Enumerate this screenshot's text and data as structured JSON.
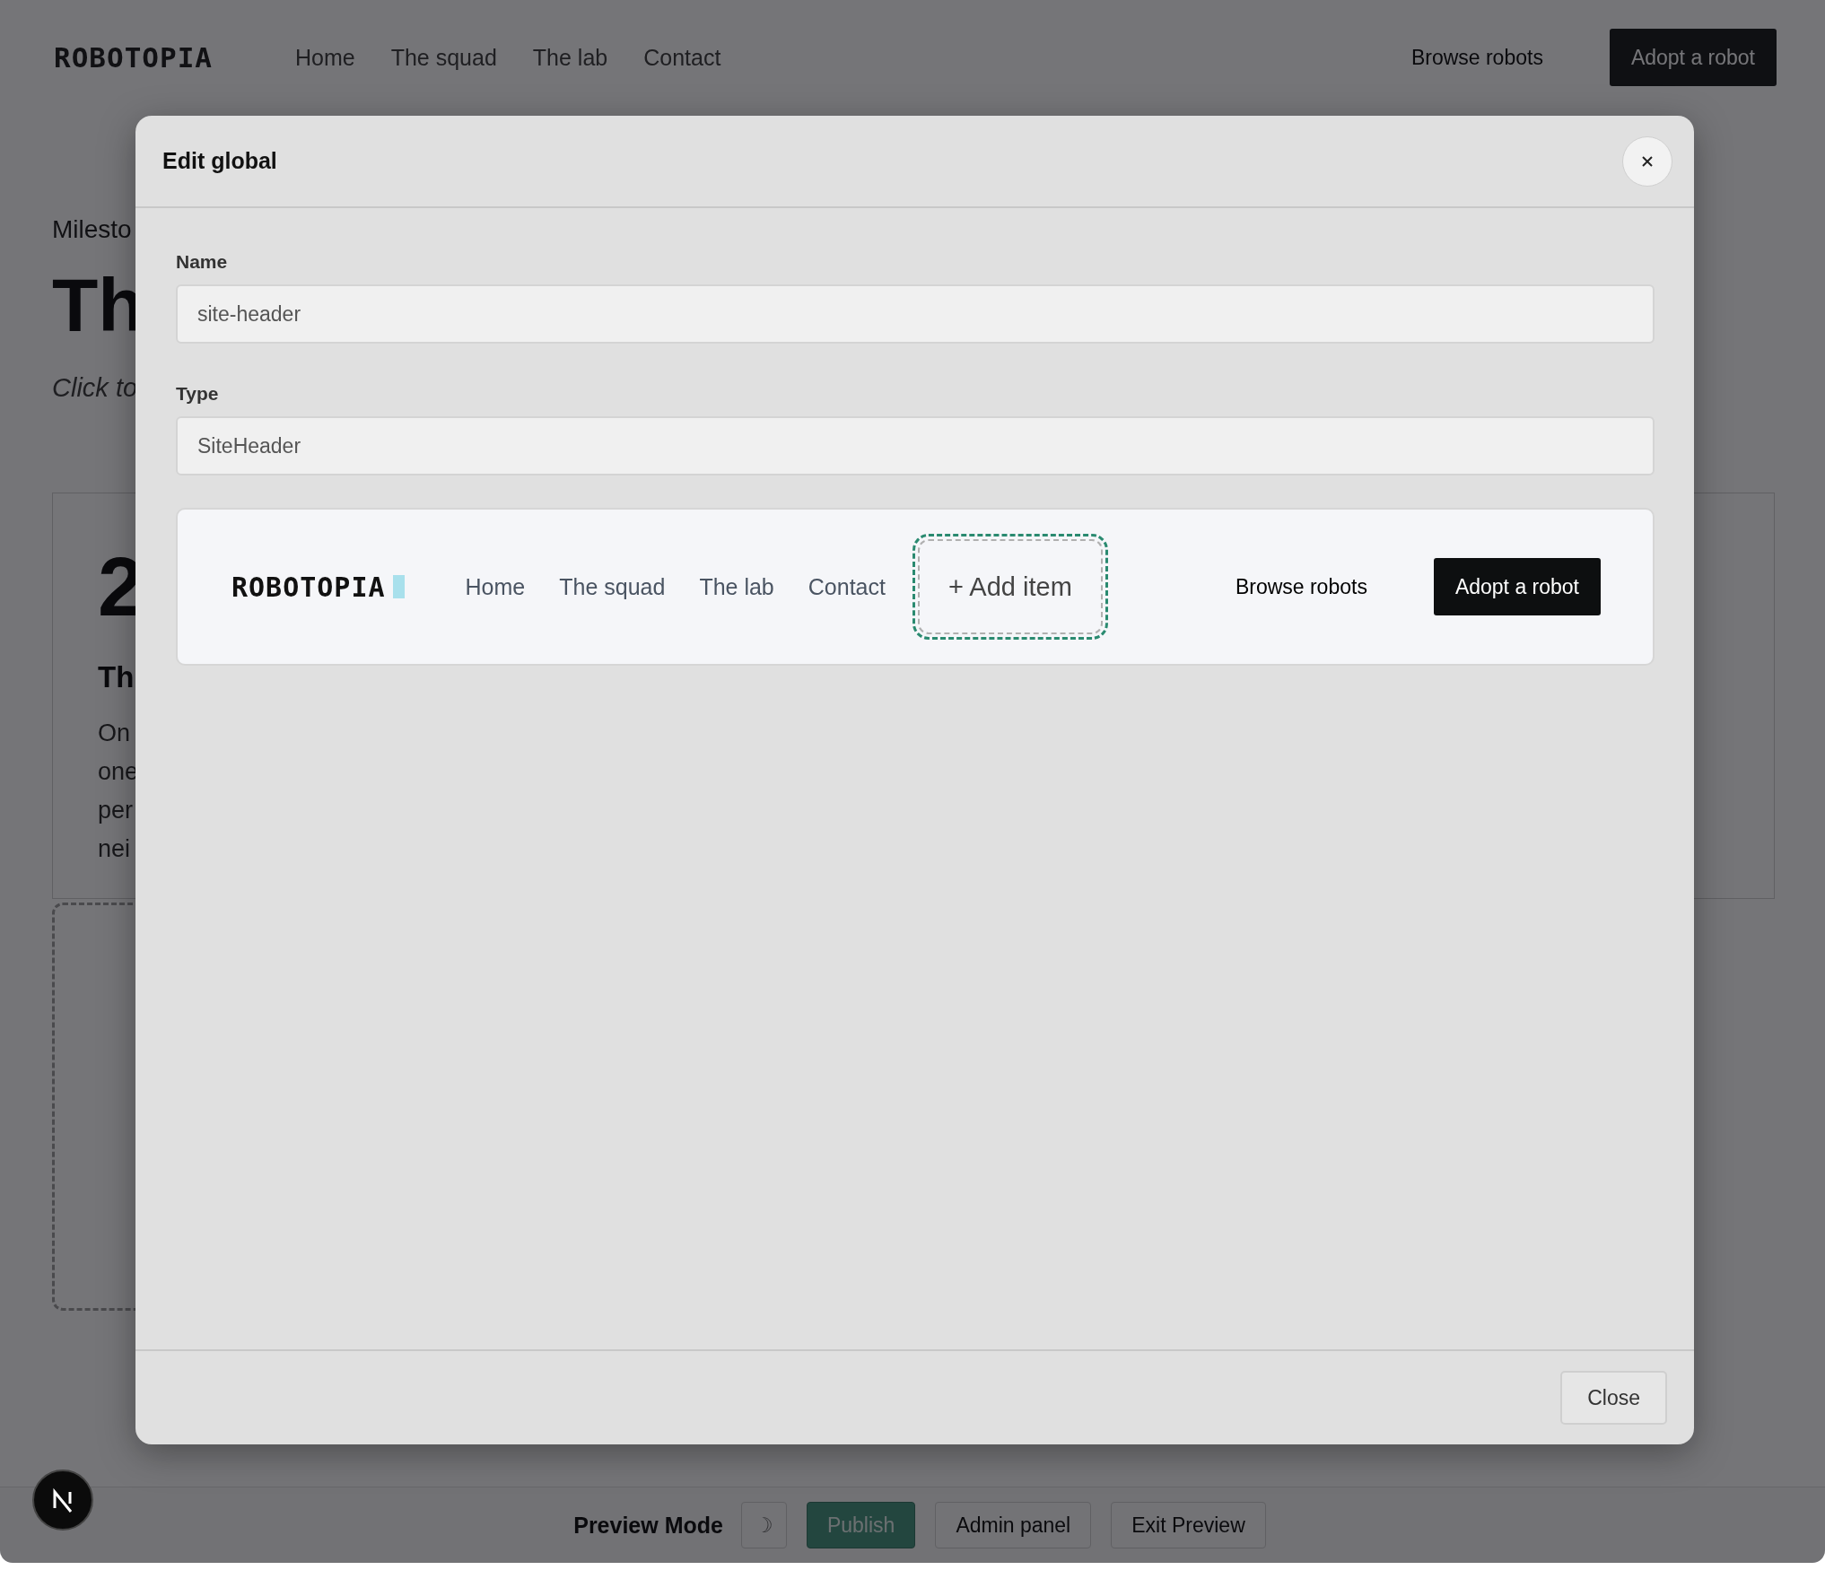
{
  "site_header": {
    "logo": "ROBOTOPIA",
    "nav": [
      "Home",
      "The squad",
      "The lab",
      "Contact"
    ],
    "link": "Browse robots",
    "cta": "Adopt a robot"
  },
  "page": {
    "eyebrow": "Milesto",
    "title": "Th",
    "subtitle": "Click to",
    "card": {
      "number": "2",
      "heading": "Th",
      "lines": [
        "On",
        "one",
        "per",
        "nei"
      ]
    }
  },
  "modal": {
    "title": "Edit global",
    "fields": [
      {
        "label": "Name",
        "value": "site-header"
      },
      {
        "label": "Type",
        "value": "SiteHeader"
      }
    ],
    "preview": {
      "logo": "ROBOTOPIA",
      "nav": [
        "Home",
        "The squad",
        "The lab",
        "Contact"
      ],
      "add_item": "+ Add item",
      "link": "Browse robots",
      "cta": "Adopt a robot"
    },
    "footer_button": "Close"
  },
  "preview_bar": {
    "label": "Preview Mode",
    "theme_toggle": "☽",
    "buttons": [
      {
        "label": "Publish",
        "kind": "primary"
      },
      {
        "label": "Admin panel",
        "kind": "secondary"
      },
      {
        "label": "Exit Preview",
        "kind": "secondary"
      }
    ]
  }
}
